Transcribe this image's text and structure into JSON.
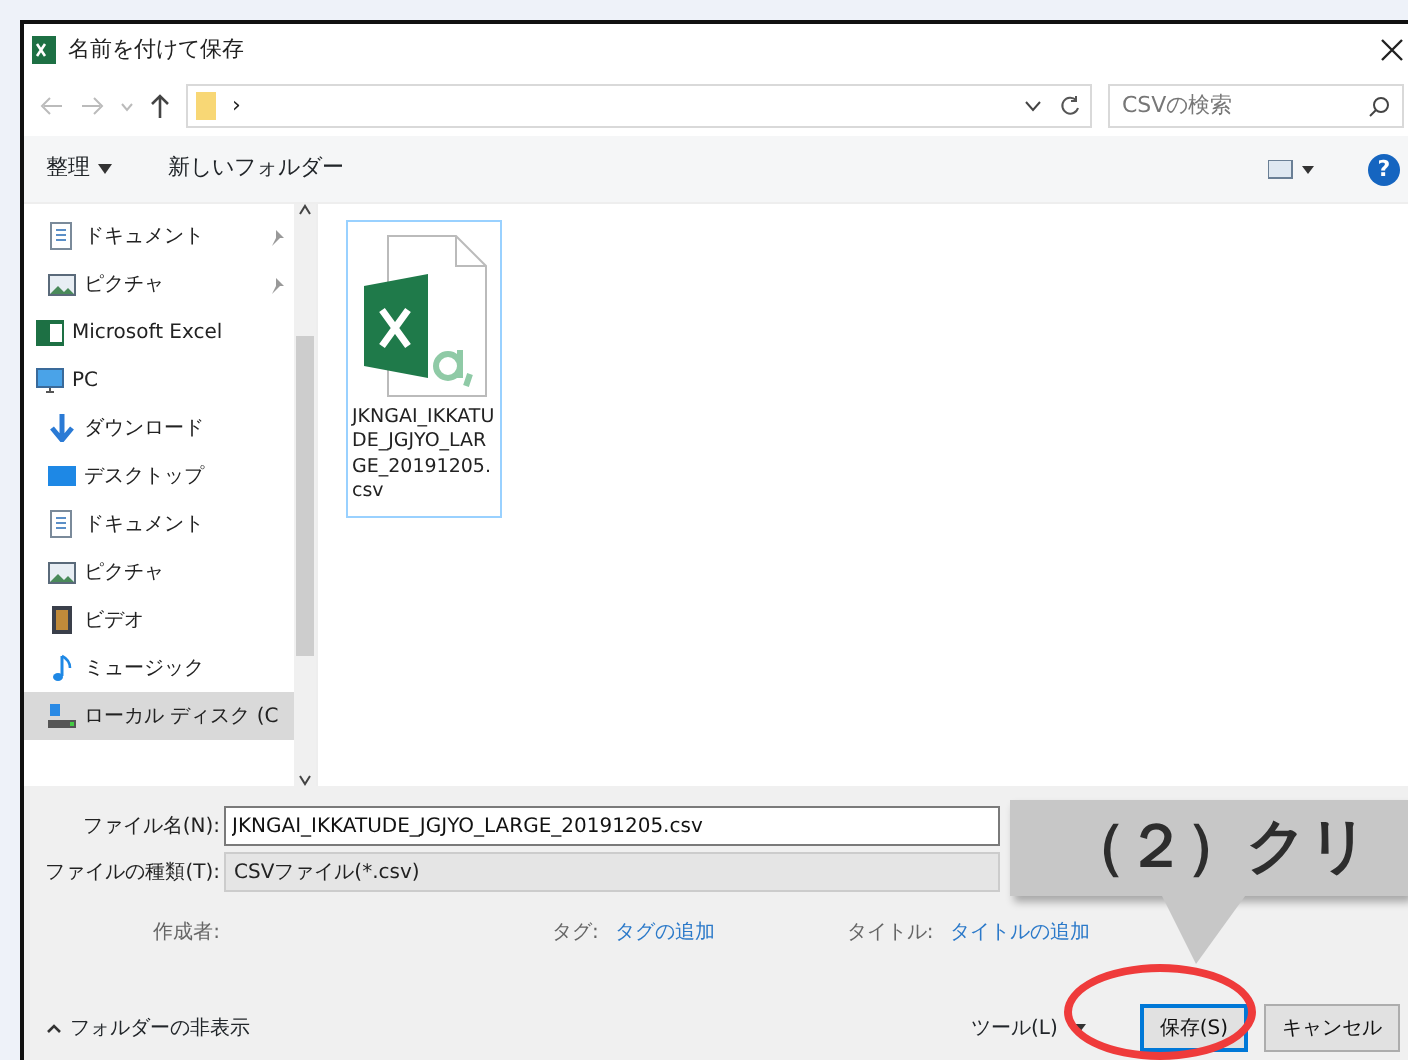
{
  "window": {
    "title": "名前を付けて保存"
  },
  "address": {
    "separator": "›",
    "search_placeholder": "CSVの検索"
  },
  "toolbar": {
    "organize": "整理",
    "new_folder": "新しいフォルダー",
    "help": "?"
  },
  "sidebar": {
    "items": [
      {
        "label": "ドキュメント",
        "kind": "document",
        "pinned": true,
        "selected": false,
        "indent": true
      },
      {
        "label": "ピクチャ",
        "kind": "picture",
        "pinned": true,
        "selected": false,
        "indent": true
      },
      {
        "label": "Microsoft Excel",
        "kind": "excel",
        "pinned": false,
        "selected": false,
        "indent": false
      },
      {
        "label": "PC",
        "kind": "pc",
        "pinned": false,
        "selected": false,
        "indent": false
      },
      {
        "label": "ダウンロード",
        "kind": "download",
        "pinned": false,
        "selected": false,
        "indent": true
      },
      {
        "label": "デスクトップ",
        "kind": "desktop",
        "pinned": false,
        "selected": false,
        "indent": true
      },
      {
        "label": "ドキュメント",
        "kind": "document",
        "pinned": false,
        "selected": false,
        "indent": true
      },
      {
        "label": "ピクチャ",
        "kind": "picture",
        "pinned": false,
        "selected": false,
        "indent": true
      },
      {
        "label": "ビデオ",
        "kind": "video",
        "pinned": false,
        "selected": false,
        "indent": true
      },
      {
        "label": "ミュージック",
        "kind": "music",
        "pinned": false,
        "selected": false,
        "indent": true
      },
      {
        "label": "ローカル ディスク (C",
        "kind": "drive",
        "pinned": false,
        "selected": true,
        "indent": true
      }
    ]
  },
  "files": [
    {
      "name": "JKNGAI_IKKATUDE_JGJYO_LARGE_20191205.csv",
      "selected": true
    }
  ],
  "form": {
    "filename_label": "ファイル名(N):",
    "filename": "JKNGAI_IKKATUDE_JGJYO_LARGE_20191205.csv",
    "type_label": "ファイルの種類(T):",
    "type": "CSVファイル(*.csv)",
    "author_label": "作成者:",
    "tags_label": "タグ:",
    "tags_value": "タグの追加",
    "title_label": "タイトル:",
    "title_value": "タイトルの追加"
  },
  "footer": {
    "hide_folders": "フォルダーの非表示",
    "tools": "ツール(L)",
    "save": "保存(S)",
    "cancel": "キャンセル"
  },
  "callout": {
    "text": "（２）クリ"
  }
}
